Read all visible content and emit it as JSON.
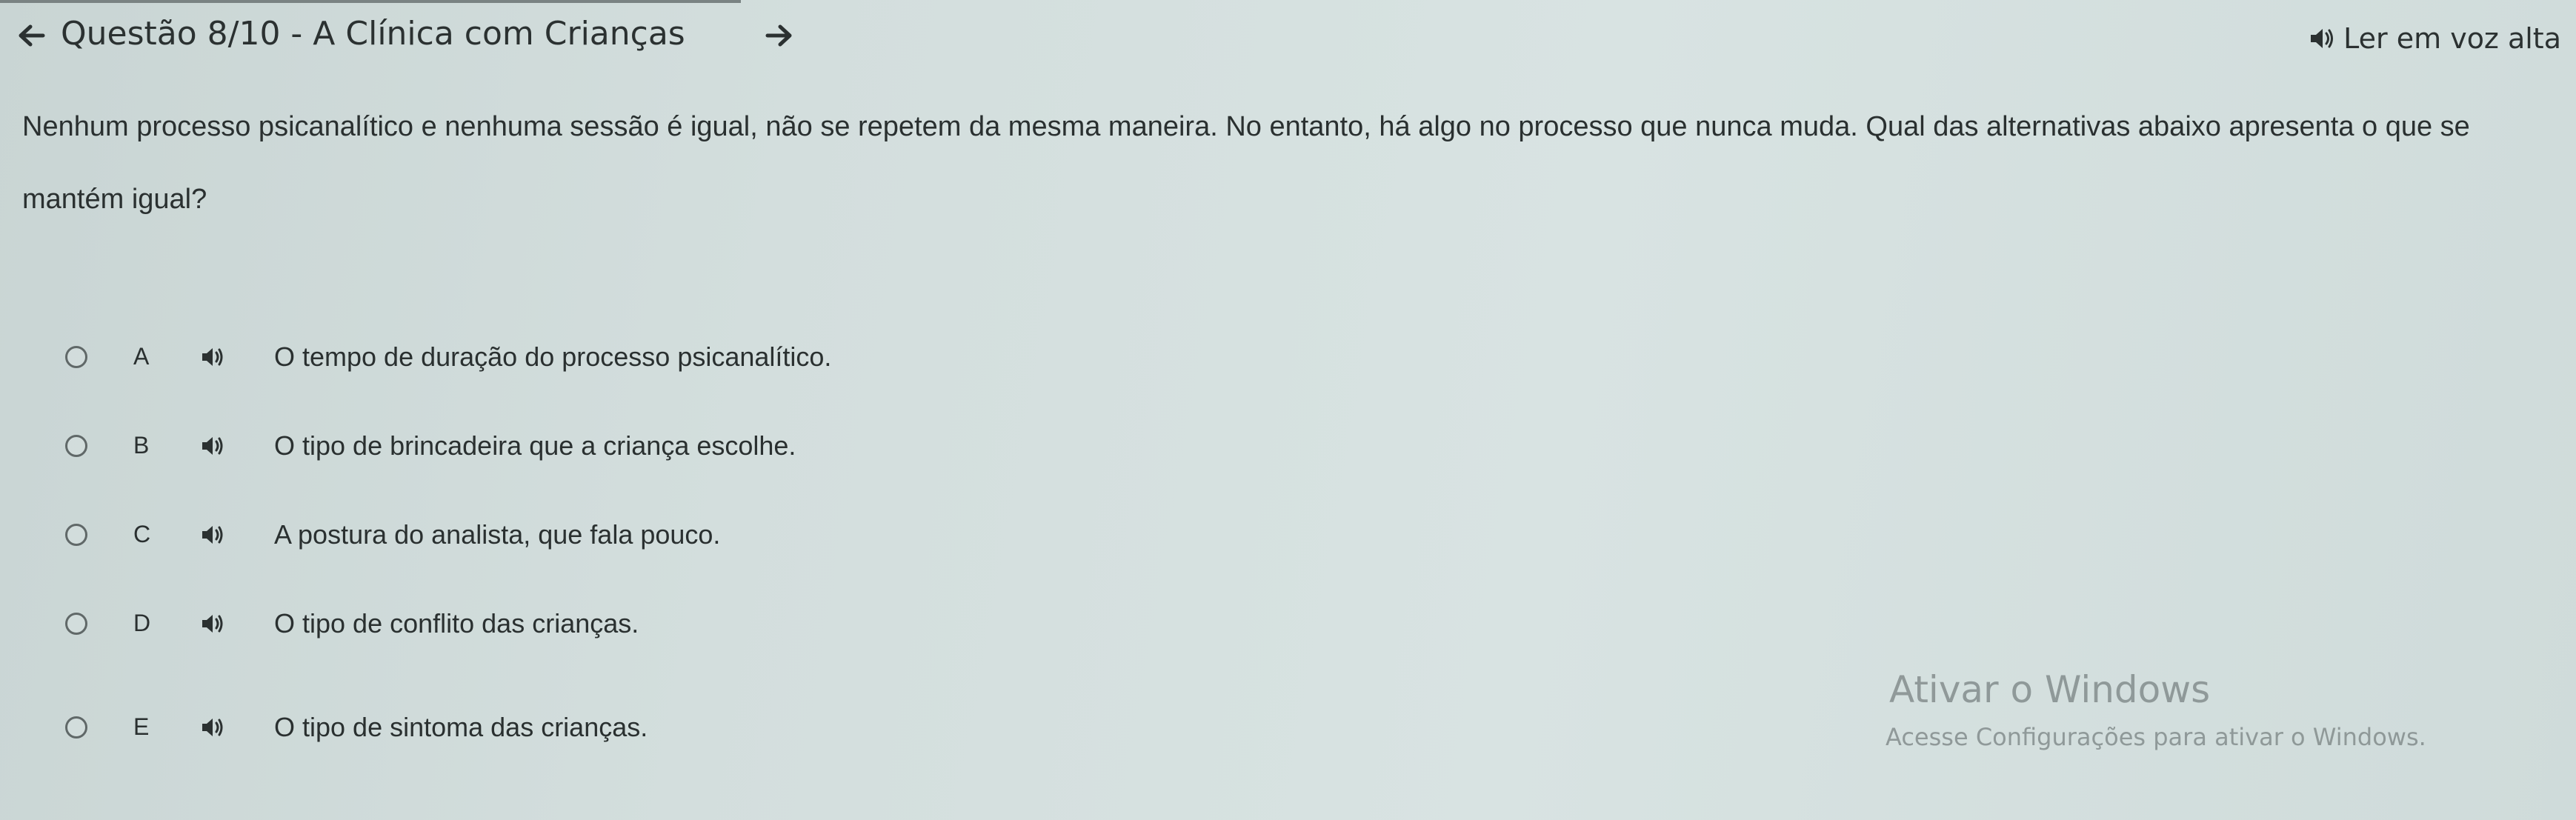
{
  "header": {
    "title": "Questão 8/10 - A Clínica com Crianças",
    "prev_icon": "arrow-left-icon",
    "next_icon": "arrow-right-icon",
    "read_aloud_label": "Ler em voz alta",
    "read_aloud_icon": "speaker-icon"
  },
  "question": {
    "text": "Nenhum processo psicanalítico e nenhuma sessão é igual, não se repetem da mesma maneira. No entanto, há algo no processo que nunca muda. Qual das alternativas abaixo apresenta o que se mantém igual?"
  },
  "options": [
    {
      "letter": "A",
      "text": "O tempo de duração do processo psicanalítico."
    },
    {
      "letter": "B",
      "text": "O tipo de brincadeira que a criança escolhe."
    },
    {
      "letter": "C",
      "text": "A postura do analista, que fala pouco."
    },
    {
      "letter": "D",
      "text": "O tipo de conflito das crianças."
    },
    {
      "letter": "E",
      "text": "O tipo de sintoma das crianças."
    }
  ],
  "watermark": {
    "title": "Ativar o Windows",
    "subtitle": "Acesse Configurações para ativar o Windows."
  },
  "colors": {
    "background": "#d3dedd",
    "text": "#2a3030",
    "watermark": "#7a8282"
  }
}
